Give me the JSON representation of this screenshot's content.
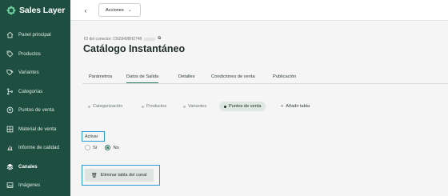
{
  "brand": {
    "name": "Sales Layer"
  },
  "sidebar": {
    "items": [
      {
        "label": "Panel principal",
        "icon": "home-icon"
      },
      {
        "label": "Productos",
        "icon": "tag-icon"
      },
      {
        "label": "Variantes",
        "icon": "tags-icon"
      },
      {
        "label": "Categorías",
        "icon": "tree-icon"
      },
      {
        "label": "Puntos de venta",
        "icon": "pin-icon"
      },
      {
        "label": "Material de venta",
        "icon": "grid-icon"
      },
      {
        "label": "Informe de calidad",
        "icon": "chart-icon"
      },
      {
        "label": "Canales",
        "icon": "layers-icon",
        "active": true
      },
      {
        "label": "Imágenes",
        "icon": "image-icon"
      }
    ]
  },
  "topbar": {
    "back": "‹",
    "actions_label": "Acciones",
    "actions_chevron": "⌄"
  },
  "header": {
    "connector_id_label": "ID del conector: CN29498H2748",
    "title": "Catálogo Instantáneo"
  },
  "tabs": [
    "Parámetros",
    "Datos de Salida",
    "Detalles",
    "Condiciones de venta",
    "Publicación"
  ],
  "active_tab": "Datos de Salida",
  "subtabs": [
    "Categorización",
    "Productos",
    "Variantes",
    "Puntos de venta"
  ],
  "active_subtab": "Puntos de venta",
  "add_table_label": "Añadir tabla",
  "activar": {
    "label": "Activar",
    "option_yes": "Sí",
    "option_no": "No",
    "selected": "No"
  },
  "delete_button_label": "Eliminar tabla del canal",
  "colors": {
    "sidebar": "#1d4e3f",
    "accent": "#2a7a5e",
    "highlight": "#2a9bd3"
  }
}
